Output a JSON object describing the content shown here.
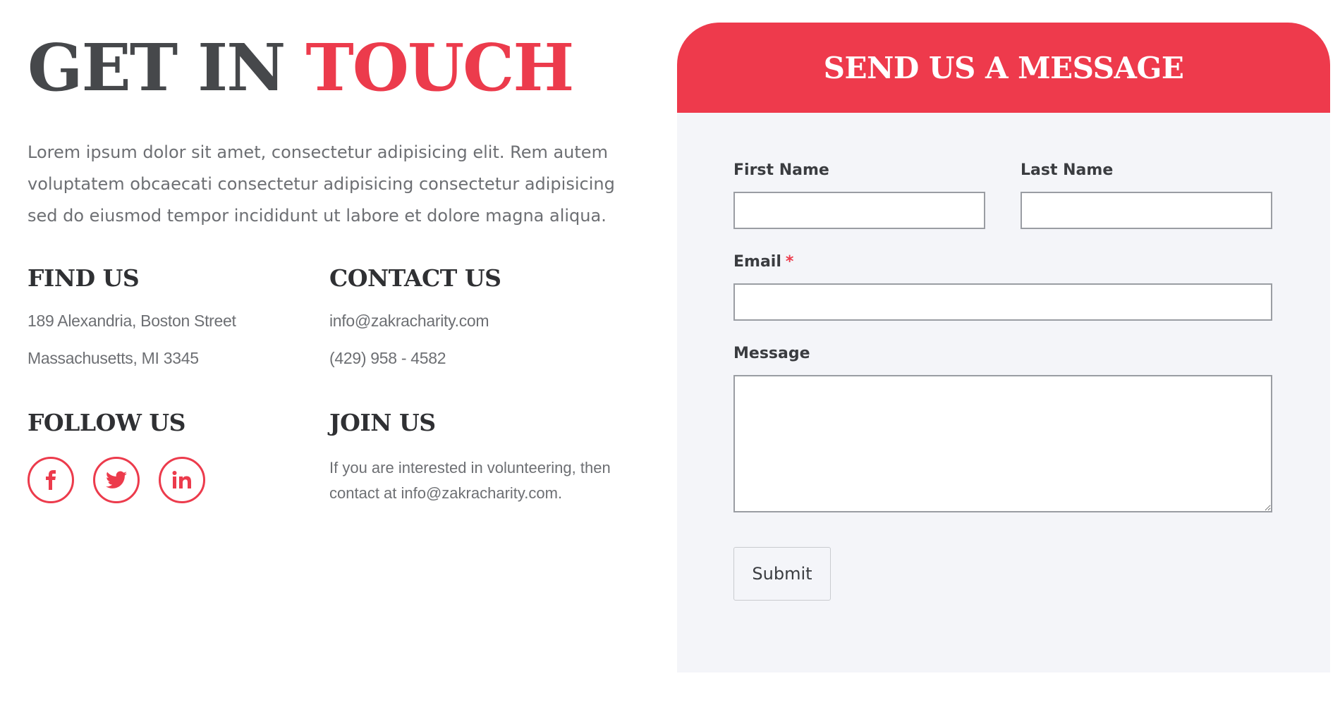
{
  "heading": {
    "part1": "GET IN",
    "part2": "TOUCH"
  },
  "intro": "Lorem ipsum dolor sit amet, consectetur adipisicing elit. Rem autem voluptatem obcaecati consectetur adipisicing consectetur adipisicing sed do eiusmod tempor incididunt ut labore et dolore magna aliqua.",
  "find_us": {
    "title": "FIND US",
    "line1": "189 Alexandria, Boston Street",
    "line2": "Massachusetts, MI 3345"
  },
  "contact_us": {
    "title": "CONTACT US",
    "email": "info@zakracharity.com",
    "phone": "(429) 958 - 4582"
  },
  "follow_us": {
    "title": "FOLLOW US",
    "icons": [
      "facebook-icon",
      "twitter-icon",
      "linkedin-icon"
    ]
  },
  "join_us": {
    "title": "JOIN US",
    "text": "If you are interested in volunteering, then contact at info@zakracharity.com."
  },
  "form": {
    "title": "SEND US A MESSAGE",
    "first_name_label": "First Name",
    "last_name_label": "Last Name",
    "email_label": "Email",
    "required_mark": "*",
    "message_label": "Message",
    "first_name_value": "",
    "last_name_value": "",
    "email_value": "",
    "message_value": "",
    "submit_label": "Submit"
  },
  "colors": {
    "accent": "#ec3b4c",
    "heading_dark": "#46484b",
    "text_gray": "#6d6f73",
    "card_bg": "#f4f5f9"
  }
}
